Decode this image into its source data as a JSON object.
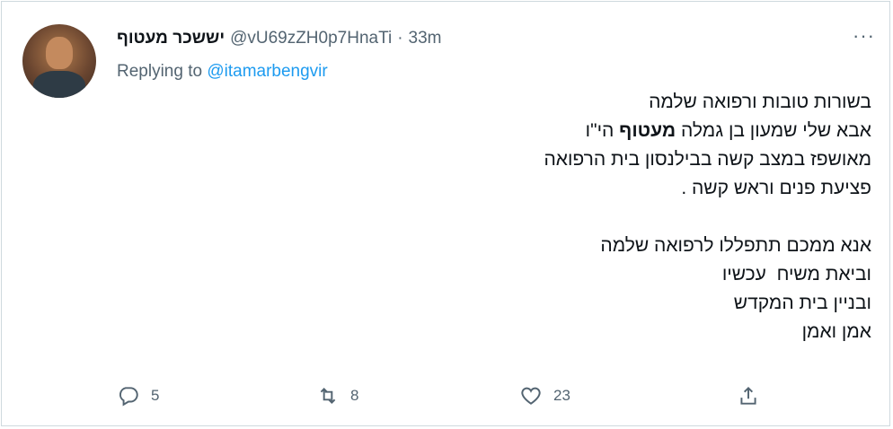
{
  "tweet": {
    "author_name": "יששכר מעטוף",
    "handle": "@vU69zZH0p7HnaTi",
    "separator": "·",
    "time": "33m",
    "more_label": "···",
    "replying_prefix": "Replying to",
    "replying_to": "@itamarbengvir",
    "lines": {
      "l1": "בשורות טובות ורפואה שלמה",
      "l2_a": "אבא שלי שמעון בן גמלה ",
      "l2_bold": "מעטוף",
      "l2_b": " הי\"ו",
      "l3": "מאושפז במצב קשה בבילנסון בית הרפואה",
      "l4": "פציעת פנים וראש קשה .",
      "l5": "",
      "l6": "אנא ממכם תתפללו לרפואה שלמה",
      "l7": "וביאת משיח  עכשיו",
      "l8": "ובניין בית המקדש",
      "l9": "אמן ואמן"
    }
  },
  "actions": {
    "reply_count": "5",
    "retweet_count": "8",
    "like_count": "23"
  },
  "icons": {
    "reply": "reply-icon",
    "retweet": "retweet-icon",
    "like": "heart-icon",
    "share": "share-icon",
    "more": "more-icon"
  },
  "colors": {
    "link": "#1d9bf0",
    "secondary": "#536471",
    "text": "#0f1419",
    "border": "#cfd9de"
  }
}
